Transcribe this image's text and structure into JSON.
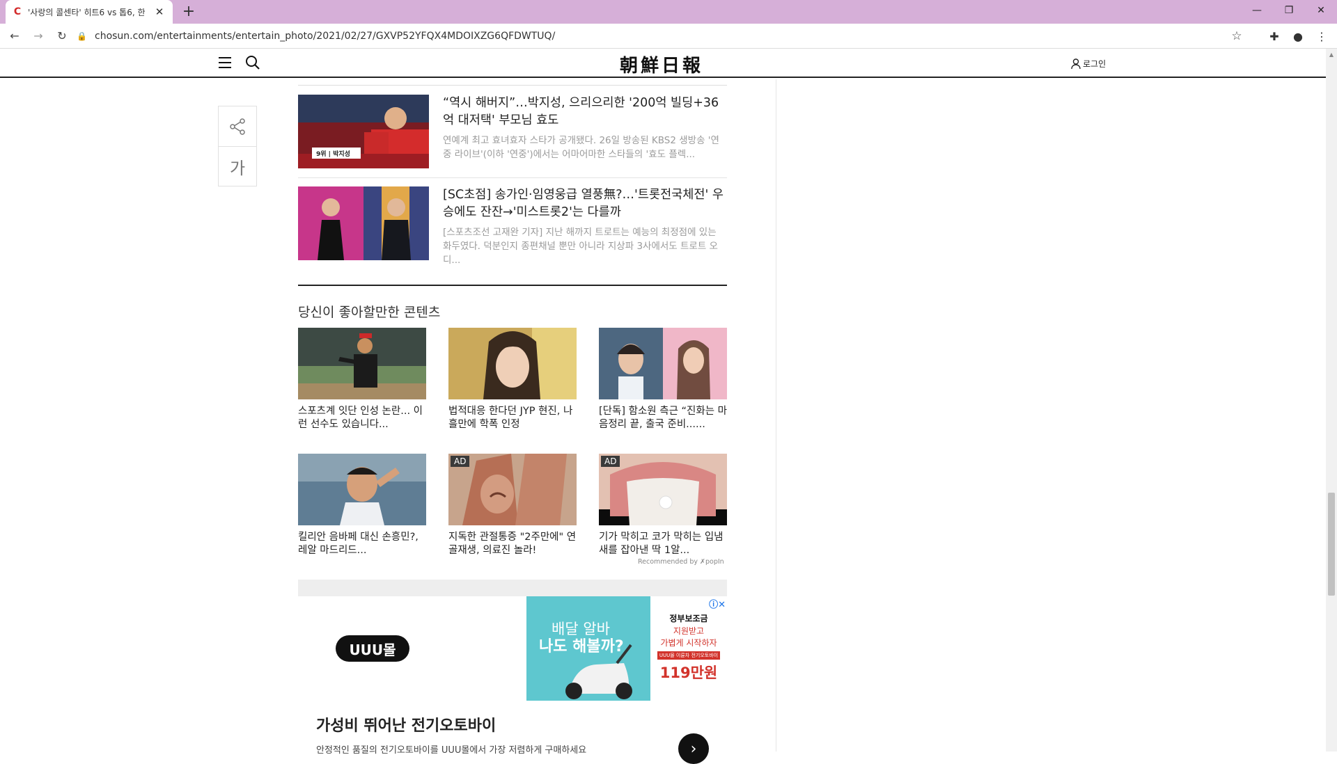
{
  "browser": {
    "tab_title": "'사랑의 콜센타' 히트6 vs 톱6, 한",
    "url": "chosun.com/entertainments/entertain_photo/2021/02/27/GXVP52YFQX4MDOIXZG6QFDWTUQ/"
  },
  "site": {
    "logo": "朝鮮日報",
    "login": "로그인"
  },
  "side_util": {
    "font_label": "가"
  },
  "articles": [
    {
      "headline": "“역시 해버지”…박지성, 으리으리한 '200억 빌딩+36억 대저택' 부모님 효도",
      "summary": "연예계 최고 효녀효자 스타가 공개됐다. 26일 방송된 KBS2 생방송 '연중 라이브'(이하 '연중')에서는 어마어마한 스타들의 '효도 플렉...",
      "thumb_caption": "9위 | 박지성"
    },
    {
      "headline": "[SC초점] 송가인·임영웅급 열풍無?…'트롯전국체전' 우승에도 잔잔→'미스트롯2'는 다를까",
      "summary": "[스포츠조선 고재완 기자] 지난 해까지 트로트는 예능의 최정점에 있는 화두였다. 덕분인지 종편채널 뿐만 아니라 지상파 3사에서도 트로트 오디..."
    }
  ],
  "recommend": {
    "title": "당신이 좋아할만한 콘텐츠",
    "items": [
      {
        "caption": "스포츠계 잇단 인성 논란... 이런 선수도 있습니다...",
        "ad": ""
      },
      {
        "caption": "법적대응 한다던 JYP 현진, 나흘만에 학폭 인정",
        "ad": ""
      },
      {
        "caption": "[단독] 함소원 측근 “진화는 마음정리 끝, 출국 준비......",
        "ad": ""
      },
      {
        "caption": "킬리안 음바페 대신 손흥민?, 레알 마드리드...",
        "ad": ""
      },
      {
        "caption": "지독한 관절통증 \"2주만에\" 연골재생, 의료진 놀라!",
        "ad": "AD"
      },
      {
        "caption": "기가 막히고 코가 막히는 입냄새를 잡아낸 딱 1알...",
        "ad": "AD"
      }
    ],
    "recommended_by": "Recommended by ✗popIn"
  },
  "ad_banner": {
    "logo": "UUU몰",
    "img_line1": "배달 알바",
    "img_line2": "나도 해볼까?",
    "panel_line1": "정부보조금",
    "panel_line2": "지원받고",
    "panel_line3": "가볍게 시작하자",
    "panel_tag": "UUU몰 이륜차 전기오토바이",
    "price": "119만원",
    "headline": "가성비 뛰어난 전기오토바이",
    "sub": "안정적인 품질의 전기오토바이를 UUU몰에서 가장 저렴하게 구매하세요"
  }
}
